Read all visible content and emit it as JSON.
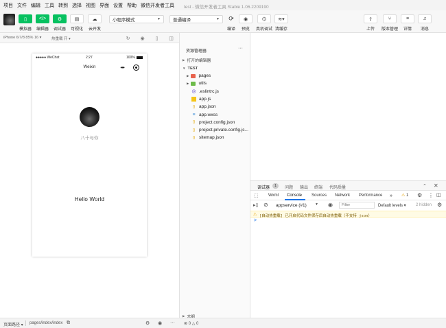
{
  "menu": [
    "项目",
    "文件",
    "编辑",
    "工具",
    "转到",
    "选择",
    "视图",
    "界面",
    "设置",
    "帮助",
    "微信开发者工具"
  ],
  "window_title": "test - 微信开发者工具 Stable 1.06.2209190",
  "toolbar": {
    "left_buttons": [
      {
        "label": "模拟器",
        "icon": "phone-icon"
      },
      {
        "label": "编辑器",
        "icon": "code-icon"
      },
      {
        "label": "调试器",
        "icon": "debug-icon"
      },
      {
        "label": "可视化",
        "icon": "layout-icon"
      },
      {
        "label": "云开发",
        "icon": "cloud-icon"
      }
    ],
    "mode_select": "小程序模式",
    "compile_select": "普通编译",
    "mid_buttons": [
      {
        "label": "编译",
        "icon": "refresh-icon"
      },
      {
        "label": "预览",
        "icon": "eye-icon"
      },
      {
        "label": "真机调试",
        "icon": "device-debug-icon"
      },
      {
        "label": "清缓存",
        "icon": "layers-icon"
      }
    ],
    "right_buttons": [
      {
        "label": "上传",
        "icon": "upload-icon"
      },
      {
        "label": "版本管理",
        "icon": "branch-icon"
      },
      {
        "label": "详情",
        "icon": "menu-icon"
      },
      {
        "label": "消息",
        "icon": "bell-icon"
      }
    ]
  },
  "simbar": {
    "device": "iPhone 6/7/8 85% 16 ▾",
    "hotreload": "热重载 开 ▾"
  },
  "phone": {
    "carrier": "●●●●● WeChat",
    "time": "2:27",
    "battery": "100%",
    "nav_title": "Weixin",
    "nickname": "八十与你",
    "hello": "Hello World"
  },
  "explorer": {
    "title": "资源管理器",
    "open_editors": "打开的编辑器",
    "project": "TEST",
    "files": [
      {
        "name": "pages",
        "type": "folder",
        "color": "#e8624c"
      },
      {
        "name": "utils",
        "type": "folder",
        "color": "#6dbb4a"
      },
      {
        "name": ".eslintrc.js",
        "type": "eslint",
        "color": "#4b32c3"
      },
      {
        "name": "app.js",
        "type": "js",
        "color": "#f5c518"
      },
      {
        "name": "app.json",
        "type": "json",
        "color": "#e4a700"
      },
      {
        "name": "app.wxss",
        "type": "wxss",
        "color": "#3b8ed8"
      },
      {
        "name": "project.config.json",
        "type": "json",
        "color": "#e4a700"
      },
      {
        "name": "project.private.config.js...",
        "type": "json",
        "color": "#e4a700"
      },
      {
        "name": "sitemap.json",
        "type": "json",
        "color": "#e4a700"
      }
    ],
    "outline": "大纲"
  },
  "devtools": {
    "top_tabs": [
      "调试器",
      "问题",
      "输出",
      "终端",
      "代码质量"
    ],
    "badge": "1",
    "console_tabs": [
      "Wxml",
      "Console",
      "Sources",
      "Network",
      "Performance"
    ],
    "warn_count": "1",
    "context": "appservice (#1)",
    "filter_placeholder": "Filter",
    "levels": "Default levels ▾",
    "hidden": "2 hidden",
    "warning_text": "[自动热重载] 已开启代码文件保存后自动热重载（不支持 json）",
    "prompt": ">"
  },
  "status": {
    "path_label": "页面路径 ▾",
    "path": "pages/index/index",
    "errors": "⊗ 0 △ 0"
  }
}
